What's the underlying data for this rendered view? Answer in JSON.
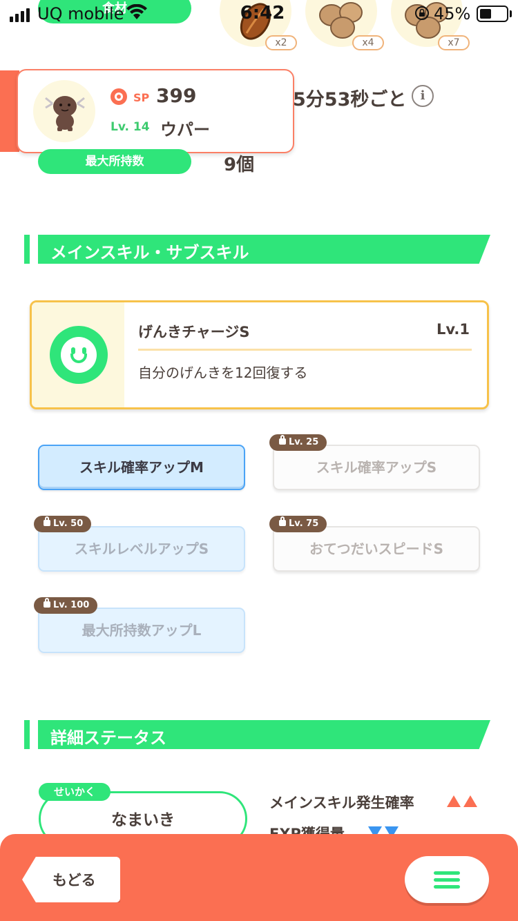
{
  "status_bar": {
    "carrier": "UQ mobile",
    "time": "6:42",
    "battery_percent": "45%",
    "battery_level": 0.45
  },
  "ingredients": {
    "tab_label": "食材",
    "items": [
      {
        "icon": "cacao-bean-icon",
        "count": "x2"
      },
      {
        "icon": "walnut-icon",
        "count": "x4"
      },
      {
        "icon": "walnut-icon",
        "count": "x7"
      }
    ]
  },
  "pokemon": {
    "sp_label": "SP",
    "sp_value": "399",
    "level_label": "Lv. 14",
    "name": "ウパー",
    "avatar_icon": "wooper-icon"
  },
  "help": {
    "interval": "5分53秒ごと",
    "max_carry_label": "最大所持数",
    "max_carry_value": "9個"
  },
  "skills_section": {
    "title": "メインスキル・サブスキル",
    "main_skill": {
      "name": "げんきチャージS",
      "level": "Lv.1",
      "description": "自分のげんきを12回復する",
      "icon": "smiley-icon"
    },
    "sub_skills": [
      {
        "label": "スキル確率アップM",
        "lock": "",
        "state": "active"
      },
      {
        "label": "スキル確率アップS",
        "lock": "Lv. 25",
        "state": "locked"
      },
      {
        "label": "スキルレベルアップS",
        "lock": "Lv. 50",
        "state": "locked"
      },
      {
        "label": "おてつだいスピードS",
        "lock": "Lv. 75",
        "state": "locked"
      },
      {
        "label": "最大所持数アップL",
        "lock": "Lv. 100",
        "state": "locked"
      }
    ]
  },
  "details_section": {
    "title": "詳細ステータス",
    "nature_label": "せいかく",
    "nature_value": "なまいき",
    "stats": [
      {
        "label": "メインスキル発生確率",
        "effect": "up"
      },
      {
        "label": "EXP獲得量",
        "effect": "down"
      }
    ]
  },
  "footer": {
    "back_label": "もどる",
    "menu_icon": "hamburger-menu-icon"
  },
  "colors": {
    "accent_green": "#2fe57a",
    "accent_orange": "#fb6f52",
    "gold_border": "#f7c24a",
    "up_arrow": "#fb6f52",
    "down_arrow": "#3a95f0"
  }
}
